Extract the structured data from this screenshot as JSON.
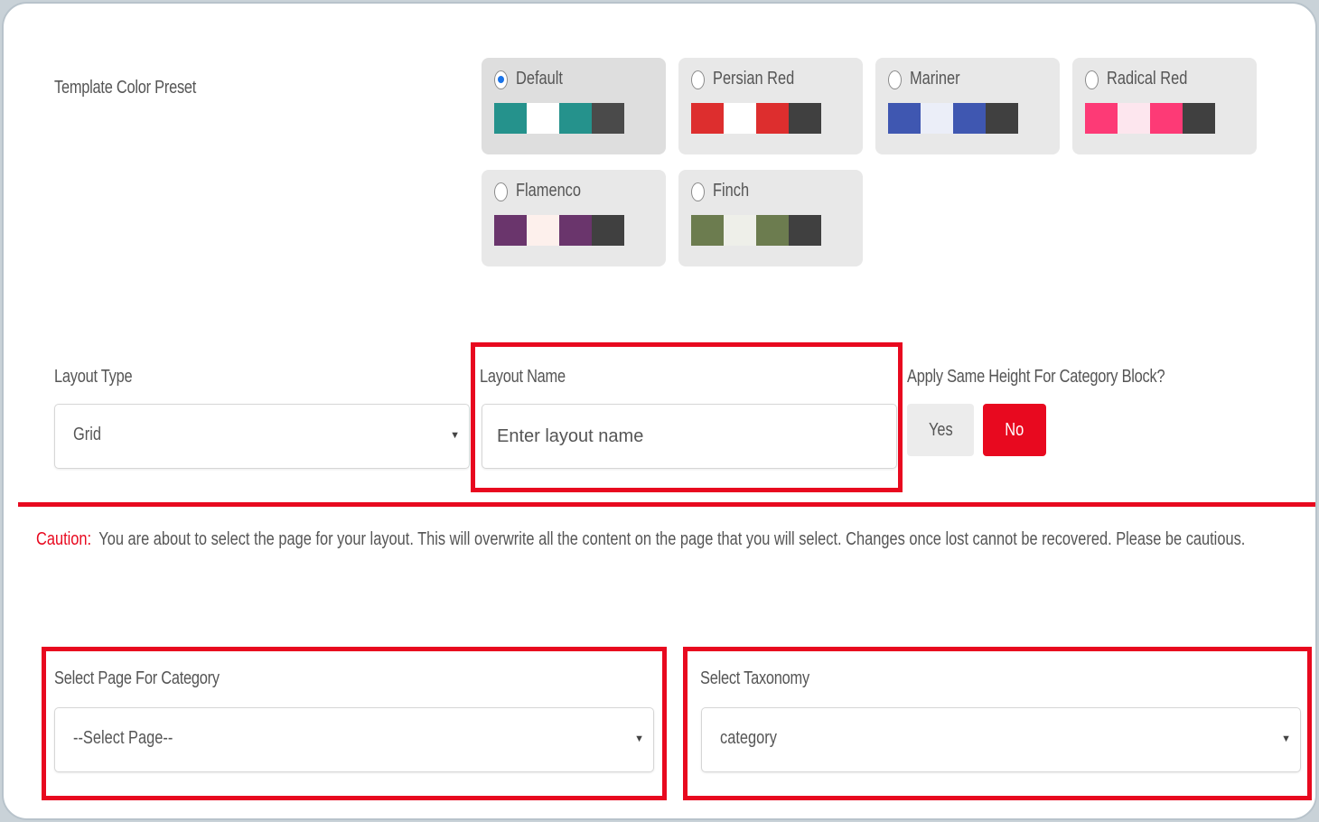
{
  "color_preset": {
    "label": "Template Color Preset",
    "options": [
      {
        "name": "Default",
        "selected": true,
        "colors": [
          "#25928c",
          "#ffffff",
          "#25928c",
          "#4a4a4a"
        ]
      },
      {
        "name": "Persian Red",
        "selected": false,
        "colors": [
          "#dd2e2e",
          "#ffffff",
          "#dd2e2e",
          "#404040"
        ]
      },
      {
        "name": "Mariner",
        "selected": false,
        "colors": [
          "#3f57b1",
          "#ebeef8",
          "#3f57b1",
          "#404040"
        ]
      },
      {
        "name": "Radical Red",
        "selected": false,
        "colors": [
          "#fd3a76",
          "#fde6ee",
          "#fd3a76",
          "#404040"
        ]
      },
      {
        "name": "Flamenco",
        "selected": false,
        "colors": [
          "#6a356c",
          "#fdf0ec",
          "#6a356c",
          "#404040"
        ]
      },
      {
        "name": "Finch",
        "selected": false,
        "colors": [
          "#6c7c4f",
          "#eeefe9",
          "#6c7c4f",
          "#404040"
        ]
      }
    ]
  },
  "layout_type": {
    "label": "Layout Type",
    "value": "Grid",
    "caret": "▼"
  },
  "layout_name": {
    "label": "Layout Name",
    "placeholder": "Enter layout name"
  },
  "same_height": {
    "label": "Apply Same Height For Category Block?",
    "yes": "Yes",
    "no": "No",
    "selected": "No"
  },
  "caution": {
    "label": "Caution:",
    "text": "You are about to select the page for your layout. This will overwrite all the content on the page that you will select. Changes once lost cannot be recovered. Please be cautious."
  },
  "select_page": {
    "label": "Select Page For Category",
    "value": "--Select Page--",
    "caret": "▼"
  },
  "select_taxonomy": {
    "label": "Select Taxonomy",
    "value": "category",
    "caret": "▼"
  },
  "colors": {
    "highlight_red": "#e8091f",
    "accent_blue": "#1a73e8"
  }
}
